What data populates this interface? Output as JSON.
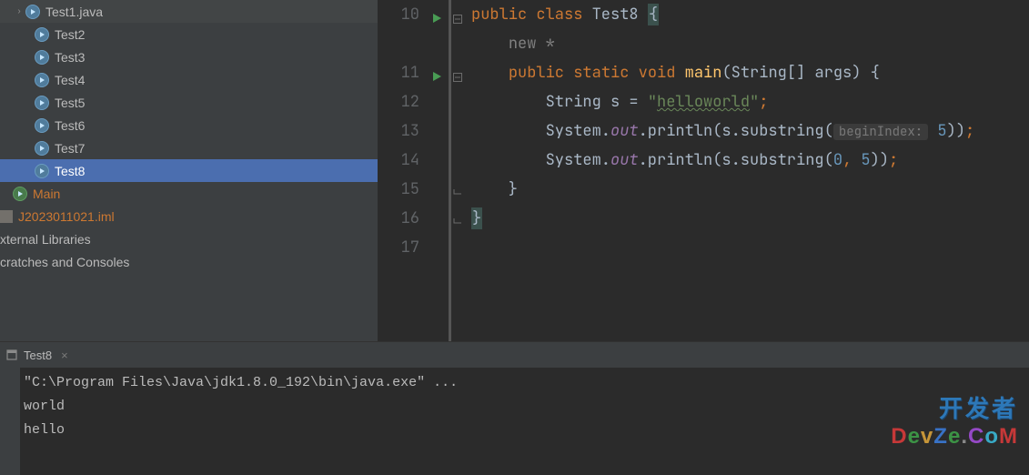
{
  "tree": {
    "items": [
      {
        "label": "Test1.java",
        "indent": 1,
        "icon": "java",
        "expander": ">"
      },
      {
        "label": "Test2",
        "indent": 2,
        "icon": "java"
      },
      {
        "label": "Test3",
        "indent": 2,
        "icon": "java"
      },
      {
        "label": "Test4",
        "indent": 2,
        "icon": "java"
      },
      {
        "label": "Test5",
        "indent": 2,
        "icon": "java"
      },
      {
        "label": "Test6",
        "indent": 2,
        "icon": "java"
      },
      {
        "label": "Test7",
        "indent": 2,
        "icon": "java"
      },
      {
        "label": "Test8",
        "indent": 2,
        "icon": "java",
        "selected": true
      },
      {
        "label": "Main",
        "indent": 1,
        "icon": "java-main",
        "orange": true
      },
      {
        "label": "J2023011021.iml",
        "indent": 0,
        "icon": "iml",
        "orange": true
      },
      {
        "label": "xternal Libraries",
        "indent": 0,
        "icon": "none"
      },
      {
        "label": "cratches and Consoles",
        "indent": 0,
        "icon": "none"
      }
    ]
  },
  "editor": {
    "lines": [
      {
        "num": "10",
        "run": true,
        "fold": "top",
        "tokens": [
          {
            "t": "public",
            "c": "kw"
          },
          {
            "t": " ",
            "c": "plain"
          },
          {
            "t": "class",
            "c": "kw"
          },
          {
            "t": " ",
            "c": "plain"
          },
          {
            "t": "Test8 ",
            "c": "plain"
          },
          {
            "t": "{",
            "c": "plain",
            "brace": true
          }
        ]
      },
      {
        "num": "",
        "tokens": [
          {
            "t": "    ",
            "c": "plain"
          },
          {
            "t": "new *",
            "c": "comment-soft"
          }
        ]
      },
      {
        "num": "11",
        "run": true,
        "fold": "top",
        "tokens": [
          {
            "t": "    ",
            "c": "plain"
          },
          {
            "t": "public",
            "c": "kw"
          },
          {
            "t": " ",
            "c": "plain"
          },
          {
            "t": "static",
            "c": "kw"
          },
          {
            "t": " ",
            "c": "plain"
          },
          {
            "t": "void",
            "c": "kw"
          },
          {
            "t": " ",
            "c": "plain"
          },
          {
            "t": "main",
            "c": "mname"
          },
          {
            "t": "(String[] args) {",
            "c": "plain"
          }
        ]
      },
      {
        "num": "12",
        "tokens": [
          {
            "t": "        String s = ",
            "c": "plain"
          },
          {
            "t": "\"",
            "c": "str"
          },
          {
            "t": "helloworld",
            "c": "str",
            "wave": true
          },
          {
            "t": "\"",
            "c": "str"
          },
          {
            "t": ";",
            "c": "kw"
          }
        ]
      },
      {
        "num": "13",
        "tokens": [
          {
            "t": "        System.",
            "c": "plain"
          },
          {
            "t": "out",
            "c": "field"
          },
          {
            "t": ".println(s.substring(",
            "c": "plain"
          },
          {
            "t": "",
            "hint": "beginIndex:"
          },
          {
            "t": " ",
            "c": "plain"
          },
          {
            "t": "5",
            "c": "num"
          },
          {
            "t": "))",
            "c": "plain"
          },
          {
            "t": ";",
            "c": "kw"
          }
        ]
      },
      {
        "num": "14",
        "tokens": [
          {
            "t": "        System.",
            "c": "plain"
          },
          {
            "t": "out",
            "c": "field"
          },
          {
            "t": ".println(s.substring(",
            "c": "plain"
          },
          {
            "t": "0",
            "c": "num"
          },
          {
            "t": ", ",
            "c": "kw"
          },
          {
            "t": "5",
            "c": "num"
          },
          {
            "t": "))",
            "c": "plain"
          },
          {
            "t": ";",
            "c": "kw"
          }
        ]
      },
      {
        "num": "15",
        "fold": "bot",
        "tokens": [
          {
            "t": "    }",
            "c": "plain"
          }
        ]
      },
      {
        "num": "16",
        "fold": "bot",
        "tokens": [
          {
            "t": "}",
            "c": "plain",
            "brace": true
          }
        ]
      },
      {
        "num": "17",
        "tokens": []
      }
    ]
  },
  "runTab": {
    "label": "Test8"
  },
  "console": {
    "lines": [
      "\"C:\\Program Files\\Java\\jdk1.8.0_192\\bin\\java.exe\" ...",
      "world",
      "hello"
    ]
  },
  "watermark": {
    "line1": "开发者",
    "line2": "DevZe.CoM"
  }
}
